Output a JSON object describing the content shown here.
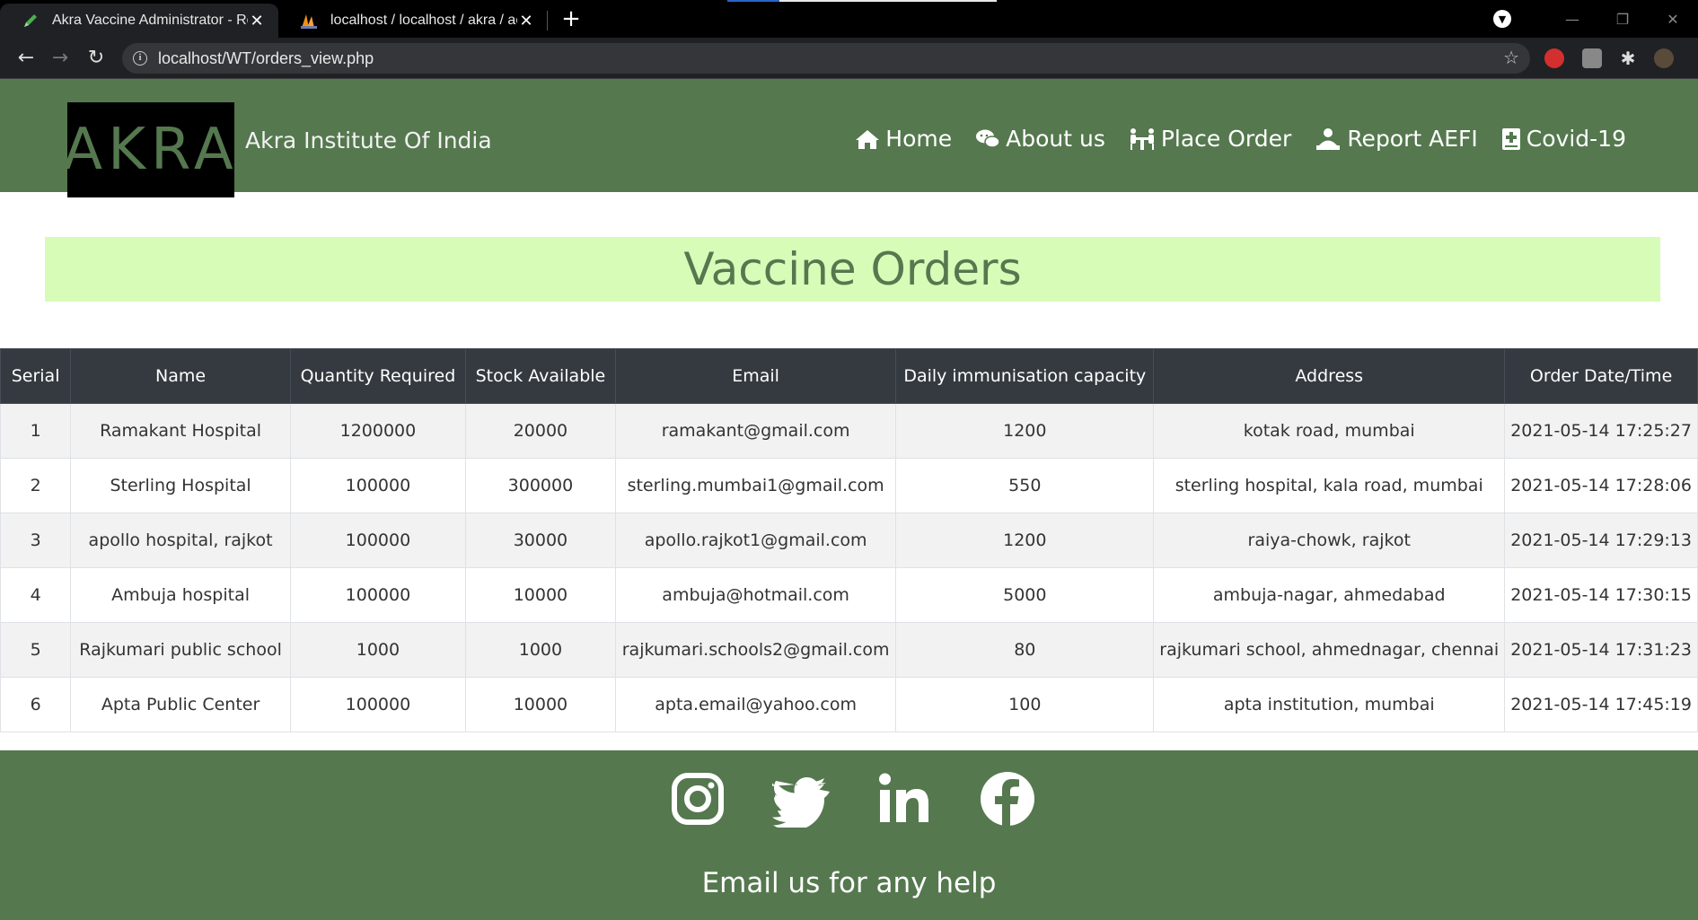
{
  "browser": {
    "tabs": [
      {
        "title": "Akra Vaccine Administrator - Rep",
        "active": true
      },
      {
        "title": "localhost / localhost / akra / aefi",
        "active": false
      }
    ],
    "new_tab": "+",
    "close": "✕",
    "url": "localhost/WT/orders_view.php"
  },
  "header": {
    "logo_text": "AKRA",
    "brand": "Akra Institute Of India",
    "nav": [
      {
        "label": "Home",
        "icon": "home-icon"
      },
      {
        "label": "About us",
        "icon": "chat-icon"
      },
      {
        "label": "Place Order",
        "icon": "people-table-icon"
      },
      {
        "label": "Report AEFI",
        "icon": "user-report-icon"
      },
      {
        "label": "Covid-19",
        "icon": "medical-book-icon"
      }
    ]
  },
  "banner": {
    "title": "Vaccine Orders"
  },
  "table": {
    "columns": [
      "Serial",
      "Name",
      "Quantity Required",
      "Stock Available",
      "Email",
      "Daily immunisation capacity",
      "Address",
      "Order Date/Time"
    ],
    "rows": [
      [
        "1",
        "Ramakant Hospital",
        "1200000",
        "20000",
        "ramakant@gmail.com",
        "1200",
        "kotak road, mumbai",
        "2021-05-14 17:25:27"
      ],
      [
        "2",
        "Sterling Hospital",
        "100000",
        "300000",
        "sterling.mumbai1@gmail.com",
        "550",
        "sterling hospital, kala road, mumbai",
        "2021-05-14 17:28:06"
      ],
      [
        "3",
        "apollo hospital, rajkot",
        "100000",
        "30000",
        "apollo.rajkot1@gmail.com",
        "1200",
        "raiya-chowk, rajkot",
        "2021-05-14 17:29:13"
      ],
      [
        "4",
        "Ambuja hospital",
        "100000",
        "10000",
        "ambuja@hotmail.com",
        "5000",
        "ambuja-nagar, ahmedabad",
        "2021-05-14 17:30:15"
      ],
      [
        "5",
        "Rajkumari public school",
        "1000",
        "1000",
        "rajkumari.schools2@gmail.com",
        "80",
        "rajkumari school, ahmednagar, chennai",
        "2021-05-14 17:31:23"
      ],
      [
        "6",
        "Apta Public Center",
        "100000",
        "10000",
        "apta.email@yahoo.com",
        "100",
        "apta institution, mumbai",
        "2021-05-14 17:45:19"
      ]
    ]
  },
  "footer": {
    "socials": [
      "instagram-icon",
      "twitter-icon",
      "linkedin-icon",
      "facebook-icon"
    ],
    "help_text": "Email us for any help"
  },
  "colors": {
    "header_green": "#55784f",
    "banner_bg": "#d7fcb8",
    "table_head": "#343a40"
  }
}
